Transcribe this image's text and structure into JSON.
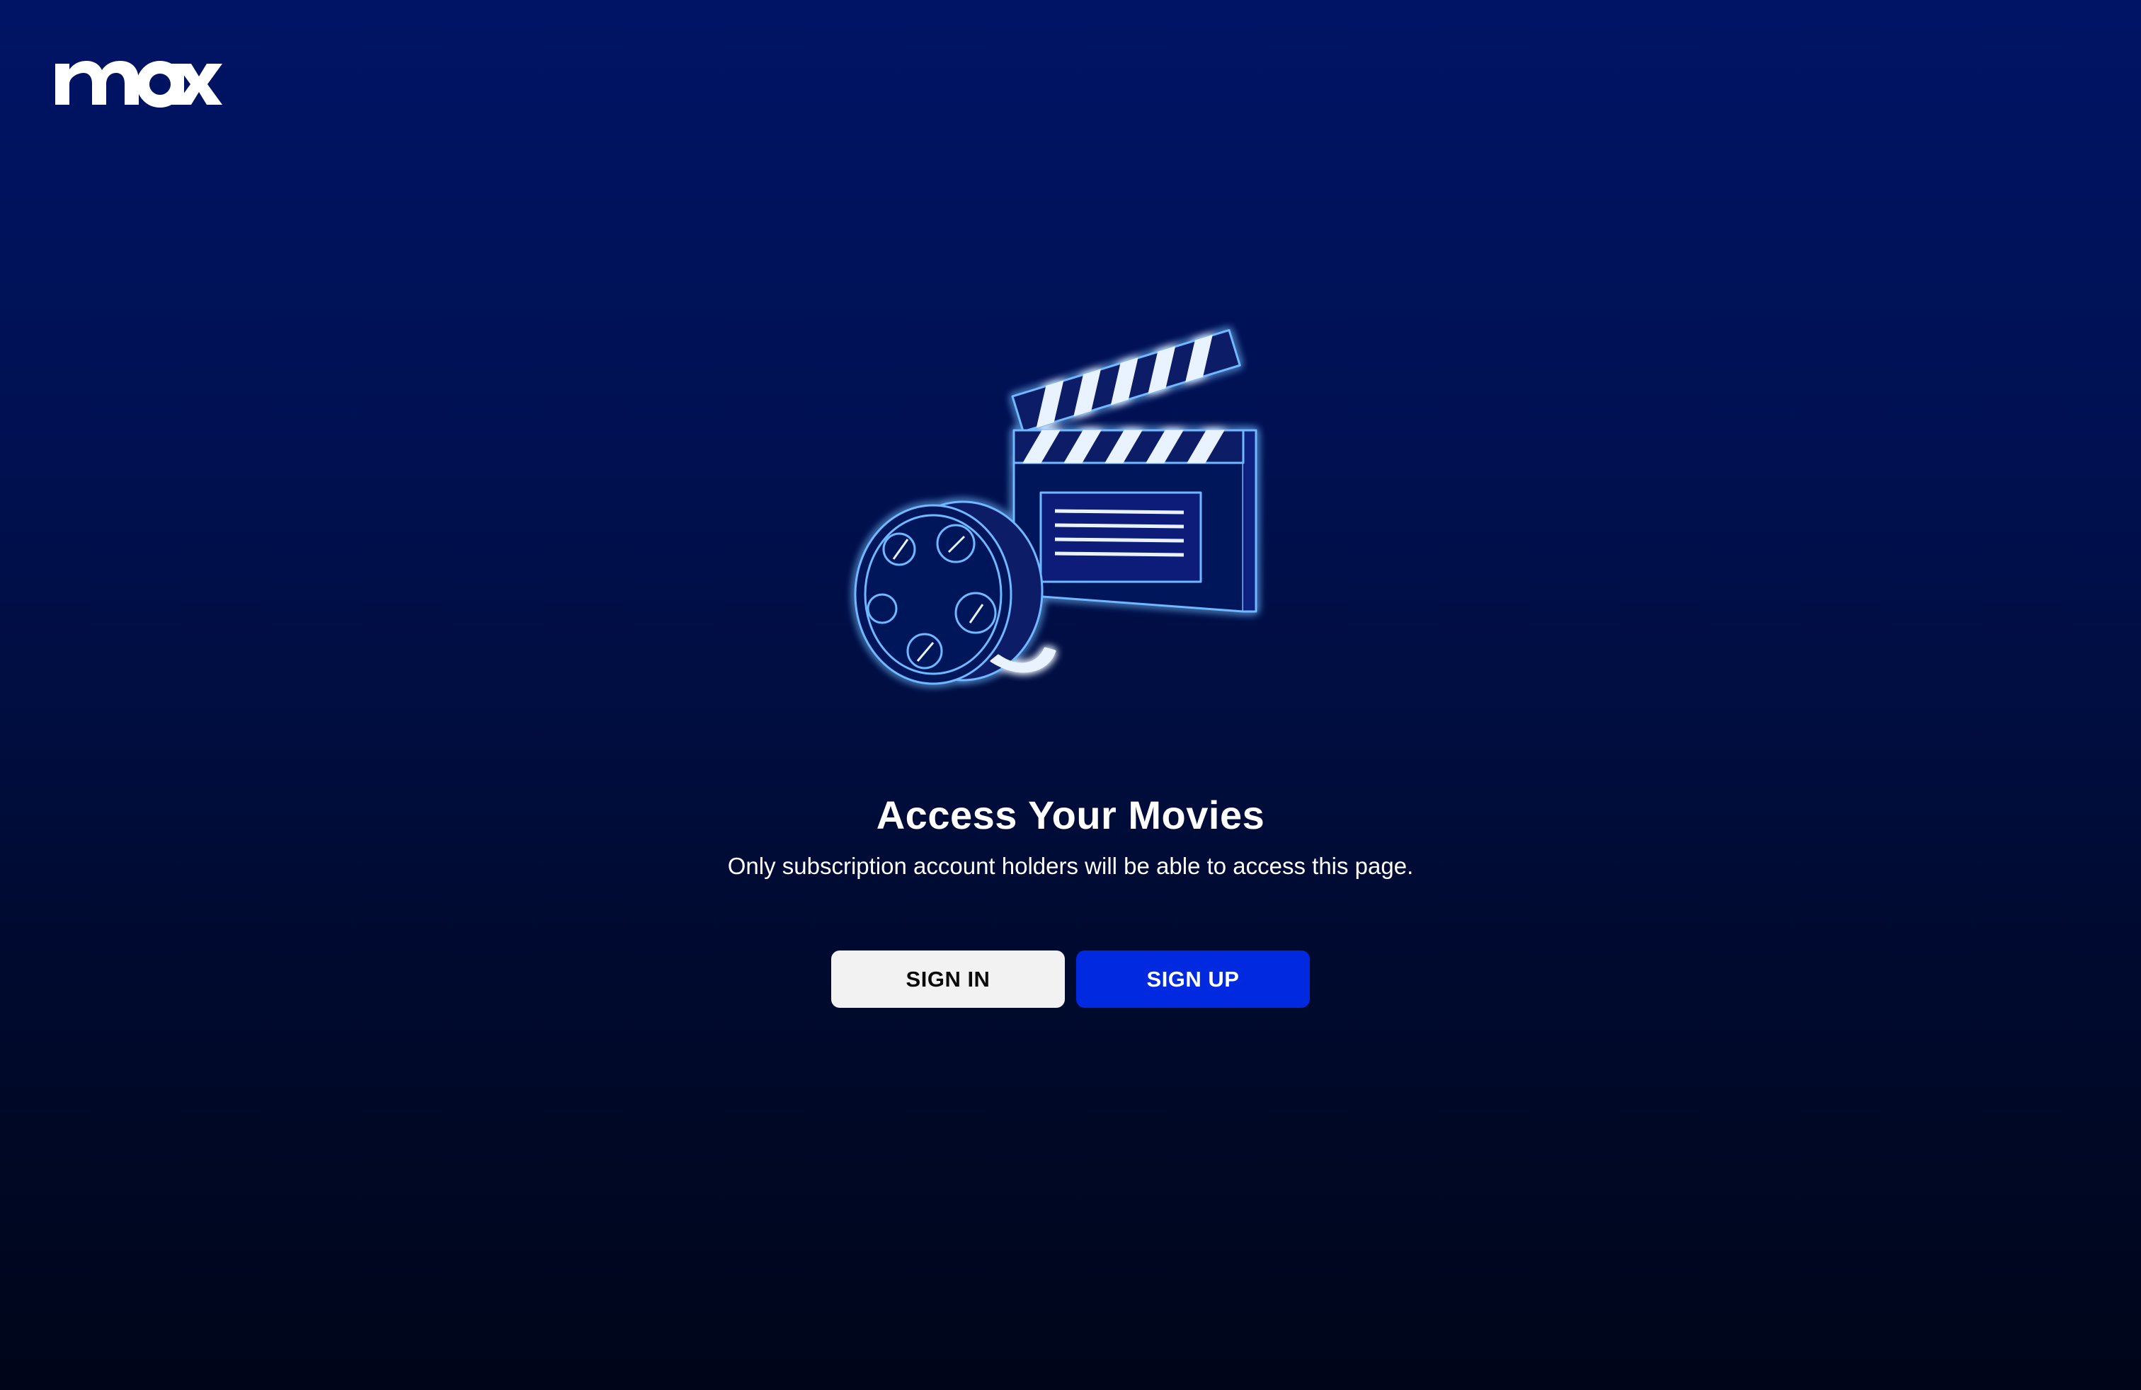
{
  "brand": {
    "logo_text": "max",
    "logo_icon": "max-logo"
  },
  "hero": {
    "illustration_icon": "movie-clapperboard-film-reel-icon",
    "title": "Access Your Movies",
    "subtitle": "Only subscription account holders will be able to access this page."
  },
  "actions": {
    "sign_in_label": "SIGN IN",
    "sign_up_label": "SIGN UP"
  },
  "colors": {
    "background_top": "#001466",
    "background_bottom": "#000519",
    "sign_in_bg": "#f2f2f2",
    "sign_up_bg": "#0029e0",
    "neon": "#58a6ff"
  }
}
